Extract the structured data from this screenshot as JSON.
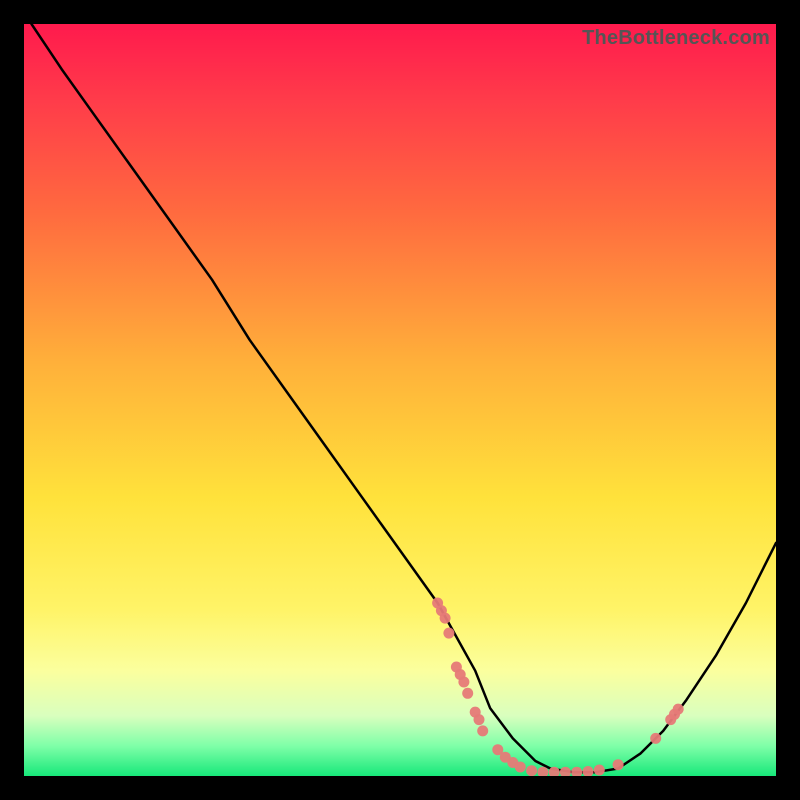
{
  "watermark": "TheBottleneck.com",
  "chart_data": {
    "type": "line",
    "title": "",
    "xlabel": "",
    "ylabel": "",
    "xlim": [
      0,
      100
    ],
    "ylim": [
      0,
      100
    ],
    "series": [
      {
        "name": "curve",
        "x": [
          1,
          5,
          10,
          15,
          20,
          25,
          30,
          35,
          40,
          45,
          50,
          55,
          60,
          62,
          65,
          68,
          70,
          73,
          76,
          79,
          82,
          85,
          88,
          92,
          96,
          100
        ],
        "y": [
          100,
          94,
          87,
          80,
          73,
          66,
          58,
          51,
          44,
          37,
          30,
          23,
          14,
          9,
          5,
          2,
          1,
          0.5,
          0.5,
          1,
          3,
          6,
          10,
          16,
          23,
          31
        ]
      }
    ],
    "markers": {
      "name": "cluster",
      "points": [
        {
          "x": 55,
          "y": 23
        },
        {
          "x": 55.5,
          "y": 22
        },
        {
          "x": 56,
          "y": 21
        },
        {
          "x": 56.5,
          "y": 19
        },
        {
          "x": 57.5,
          "y": 14.5
        },
        {
          "x": 58,
          "y": 13.5
        },
        {
          "x": 58.5,
          "y": 12.5
        },
        {
          "x": 59,
          "y": 11
        },
        {
          "x": 60,
          "y": 8.5
        },
        {
          "x": 60.5,
          "y": 7.5
        },
        {
          "x": 61,
          "y": 6
        },
        {
          "x": 63,
          "y": 3.5
        },
        {
          "x": 64,
          "y": 2.5
        },
        {
          "x": 65,
          "y": 1.8
        },
        {
          "x": 66,
          "y": 1.2
        },
        {
          "x": 67.5,
          "y": 0.7
        },
        {
          "x": 69,
          "y": 0.5
        },
        {
          "x": 70.5,
          "y": 0.5
        },
        {
          "x": 72,
          "y": 0.5
        },
        {
          "x": 73.5,
          "y": 0.5
        },
        {
          "x": 75,
          "y": 0.6
        },
        {
          "x": 76.5,
          "y": 0.8
        },
        {
          "x": 79,
          "y": 1.5
        },
        {
          "x": 84,
          "y": 5
        },
        {
          "x": 86,
          "y": 7.5
        },
        {
          "x": 86.5,
          "y": 8.2
        },
        {
          "x": 87,
          "y": 8.9
        }
      ]
    }
  }
}
